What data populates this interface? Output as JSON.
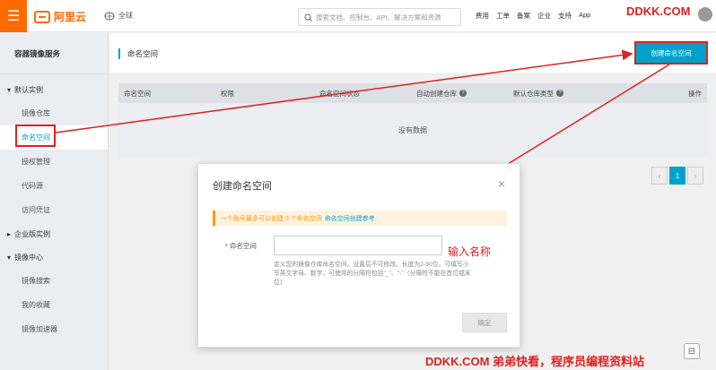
{
  "topbar": {
    "menu_icon": "☰",
    "logo_text": "阿里云",
    "region_label": "全球",
    "search_placeholder": "搜索文档、控制台、API、解决方案和资源",
    "nav_items": [
      "费用",
      "工单",
      "备案",
      "企业",
      "支持",
      "App"
    ],
    "watermark": "DDKK.COM"
  },
  "sidebar": {
    "title": "容器镜像服务",
    "group_default": "默认实例",
    "items_default": [
      "镜像仓库",
      "命名空间",
      "授权管理",
      "代码源",
      "访问凭证"
    ],
    "group_enterprise": "企业版实例",
    "group_center": "镜像中心",
    "items_center": [
      "镜像搜索",
      "我的收藏",
      "镜像加速器"
    ]
  },
  "main": {
    "page_title": "命名空间",
    "create_button": "创建命名空间",
    "columns": [
      "命名空间",
      "权限",
      "命名空间状态",
      "自动创建仓库",
      "默认仓库类型",
      "操作"
    ],
    "empty_text": "没有数据",
    "pager": {
      "prev": "‹",
      "current": "1",
      "next": "›"
    }
  },
  "modal": {
    "title": "创建命名空间",
    "close": "×",
    "tip_text": "一个账号最多可以创建 3 个命名空间",
    "tip_link": "命名空间创建参考",
    "field_label": "命名空间",
    "field_value": "",
    "hint": "定义您的镜像仓库命名空间，设置后不可修改。长度为2-30位，可填写小写英文字母、数字，可使用的分隔符包括\"_\"、\"-\"（分隔符不能在首位或末位）",
    "ok_button": "确定"
  },
  "annotation": "输入名称",
  "watermark_bottom": "DDKK.COM 弟弟快看，程序员编程资料站",
  "colors": {
    "accent": "#00a2ca",
    "brand": "#ff6a00",
    "annotation": "#e02020"
  }
}
